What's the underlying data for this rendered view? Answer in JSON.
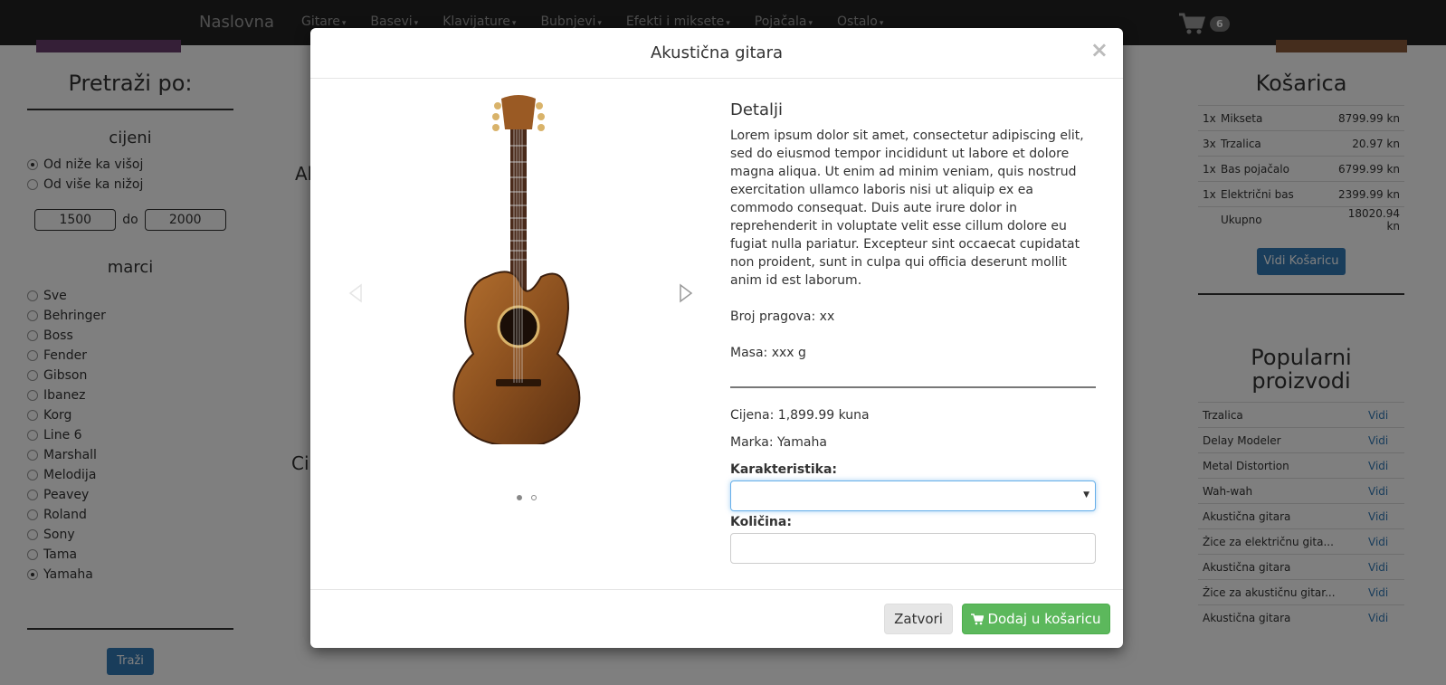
{
  "navbar": {
    "brand": "Naslovna",
    "items": [
      {
        "label": "Gitare"
      },
      {
        "label": "Basevi"
      },
      {
        "label": "Klavijature"
      },
      {
        "label": "Bubnjevi"
      },
      {
        "label": "Efekti i miksete"
      },
      {
        "label": "Pojačala"
      },
      {
        "label": "Ostalo"
      }
    ],
    "cart_count": "6"
  },
  "left_panel": {
    "title": "Pretraži po:",
    "price_heading": "cijeni",
    "sort_options": [
      {
        "label": "Od niže ka višoj",
        "checked": true
      },
      {
        "label": "Od više ka nižoj",
        "checked": false
      }
    ],
    "price_from": "1500",
    "price_sep": "do",
    "price_to": "2000",
    "brand_heading": "marci",
    "brands": [
      {
        "label": "Sve",
        "checked": false
      },
      {
        "label": "Behringer",
        "checked": false
      },
      {
        "label": "Boss",
        "checked": false
      },
      {
        "label": "Fender",
        "checked": false
      },
      {
        "label": "Gibson",
        "checked": false
      },
      {
        "label": "Ibanez",
        "checked": false
      },
      {
        "label": "Korg",
        "checked": false
      },
      {
        "label": "Line 6",
        "checked": false
      },
      {
        "label": "Marshall",
        "checked": false
      },
      {
        "label": "Melodija",
        "checked": false
      },
      {
        "label": "Peavey",
        "checked": false
      },
      {
        "label": "Roland",
        "checked": false
      },
      {
        "label": "Sony",
        "checked": false
      },
      {
        "label": "Tama",
        "checked": false
      },
      {
        "label": "Yamaha",
        "checked": true
      }
    ],
    "search_button": "Traži"
  },
  "middle_bg": {
    "text_a": "Ak",
    "text_b": "Ci"
  },
  "right_panel": {
    "cart_title": "Košarica",
    "cart_rows": [
      {
        "qty": "1x",
        "name": "Mikseta",
        "price": "8799.99 kn"
      },
      {
        "qty": "3x",
        "name": "Trzalica",
        "price": "20.97 kn"
      },
      {
        "qty": "1x",
        "name": "Bas pojačalo",
        "price": "6799.99 kn"
      },
      {
        "qty": "1x",
        "name": "Električni bas",
        "price": "2399.99 kn"
      },
      {
        "qty": "",
        "name": "Ukupno",
        "price": "18020.94 kn"
      }
    ],
    "view_cart_button": "Vidi Košaricu",
    "popular_title": "Popularni proizvodi",
    "popular_rows": [
      {
        "name": "Trzalica",
        "link": "Vidi"
      },
      {
        "name": "Delay Modeler",
        "link": "Vidi"
      },
      {
        "name": "Metal Distortion",
        "link": "Vidi"
      },
      {
        "name": "Wah-wah",
        "link": "Vidi"
      },
      {
        "name": "Akustična gitara",
        "link": "Vidi"
      },
      {
        "name": "Žice za električnu gita...",
        "link": "Vidi"
      },
      {
        "name": "Akustična gitara",
        "link": "Vidi"
      },
      {
        "name": "Žice za akustičnu gitar...",
        "link": "Vidi"
      },
      {
        "name": "Akustična gitara",
        "link": "Vidi"
      }
    ]
  },
  "modal": {
    "title": "Akustična gitara",
    "close_glyph": "×",
    "details_heading": "Detalji",
    "description": "Lorem ipsum dolor sit amet, consectetur adipiscing elit, sed do eiusmod tempor incididunt ut labore et dolore magna aliqua. Ut enim ad minim veniam, quis nostrud exercitation ullamco laboris nisi ut aliquip ex ea commodo consequat. Duis aute irure dolor in reprehenderit in voluptate velit esse cillum dolore eu fugiat nulla pariatur. Excepteur sint occaecat cupidatat non proident, sunt in culpa qui officia deserunt mollit anim id est laborum.",
    "frets": "Broj pragova: xx",
    "mass": "Masa: xxx g",
    "price": "Cijena: 1,899.99 kuna",
    "brand": "Marka: Yamaha",
    "feature_label": "Karakteristika:",
    "feature_value": "",
    "quantity_label": "Količina:",
    "quantity_value": "",
    "close_button": "Zatvori",
    "add_button": "Dodaj u košaricu"
  }
}
